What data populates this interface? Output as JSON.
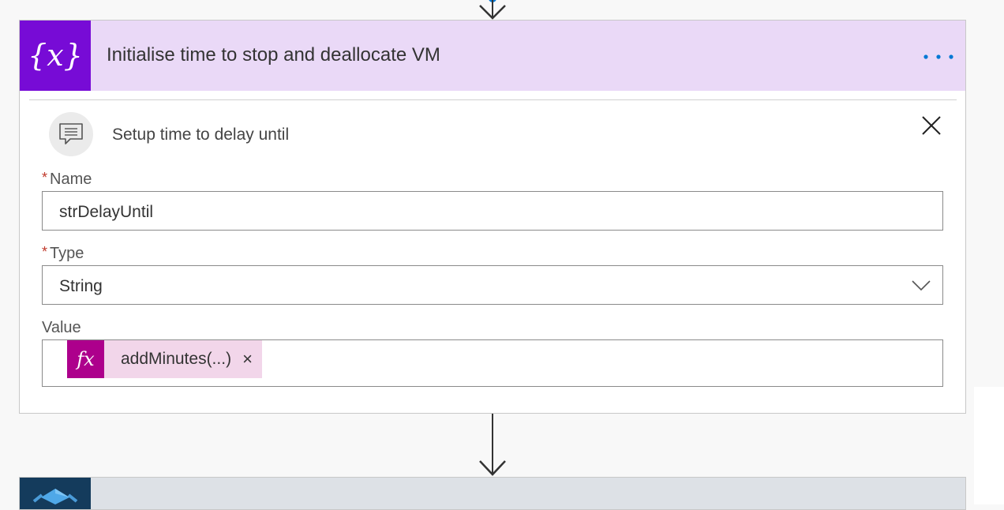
{
  "colors": {
    "header_bg": "#ead9f7",
    "header_icon_bg": "#770bd6",
    "more_dots": "#0078d4",
    "token_fx_bg": "#ad008c",
    "token_bg": "#f2d6ea",
    "required_star": "#c0392b",
    "next_card_icon_bg": "#143b5c"
  },
  "action": {
    "icon": "variable-braces-icon",
    "icon_text": "{x}",
    "title": "Initialise time to stop and deallocate VM",
    "more_icon": "more-dots-icon",
    "comment": {
      "icon": "comment-icon",
      "text": "Setup time to delay until",
      "close_icon": "close-icon"
    },
    "fields": {
      "name": {
        "required_mark": "*",
        "label": "Name",
        "value": "strDelayUntil"
      },
      "type": {
        "required_mark": "*",
        "label": "Type",
        "value": "String",
        "icon": "chevron-down-icon"
      },
      "value": {
        "label": "Value",
        "token": {
          "icon_text": "fx",
          "label": "addMinutes(...)",
          "remove": "×"
        }
      }
    }
  },
  "connectors": [
    {
      "icon": "arrow-down-icon"
    },
    {
      "icon": "arrow-down-icon"
    }
  ],
  "next_action": {
    "icon": "azure-vm-icon"
  }
}
